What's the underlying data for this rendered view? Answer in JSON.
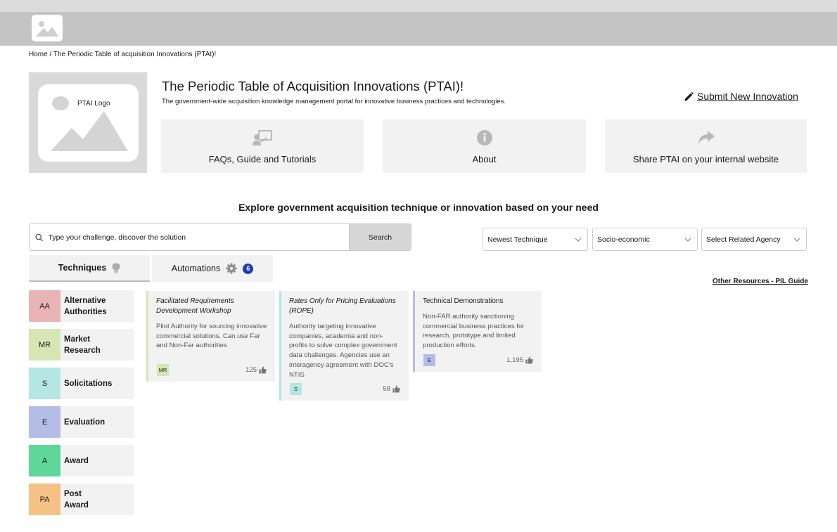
{
  "breadcrumb": {
    "home": "Home",
    "separator": " / ",
    "current": "The Periodic Table of acquisition Innovations (PTAI)!"
  },
  "hero": {
    "logo_label": "PTAI Logo",
    "title": "The Periodic Table of Acquisition Innovations (PTAI)!",
    "subtitle": "The government-wide acquisition knowledge management portal for innovative business practices and technologies.",
    "submit_label": "Submit New Innovation"
  },
  "actions": [
    {
      "label": "FAQs, Guide and Tutorials",
      "icon": "presentation-icon"
    },
    {
      "label": "About",
      "icon": "info-icon"
    },
    {
      "label": "Share PTAI on your internal website",
      "icon": "share-icon"
    }
  ],
  "explore_heading": "Explore government acquisition technique or innovation based on your need",
  "search": {
    "placeholder": "Type your challenge, discover the solution",
    "button": "Search"
  },
  "filters": [
    {
      "value": "Newest Technique"
    },
    {
      "value": "Socio-economic"
    },
    {
      "value": "Select Related Agency"
    }
  ],
  "tabs": [
    {
      "label": "Techniques",
      "icon": "lightbulb-icon",
      "active": true
    },
    {
      "label": "Automations",
      "icon": "gear-icon",
      "badge": "6"
    }
  ],
  "other_resources": "Other Resources - PIL Guide",
  "categories": [
    {
      "code": "AA",
      "name": "Alternative Authorities",
      "color": "#e8b4b4"
    },
    {
      "code": "MR",
      "name": "Market Research",
      "color": "#d6e6b4"
    },
    {
      "code": "S",
      "name": "Solicitations",
      "color": "#b4e6e4"
    },
    {
      "code": "E",
      "name": "Evaluation",
      "color": "#b4bce8"
    },
    {
      "code": "A",
      "name": "Award",
      "color": "#5fd69a"
    },
    {
      "code": "PA",
      "name": "Post Award",
      "color": "#f5c184"
    }
  ],
  "techniques": [
    {
      "title": "Facilitated Requirements Development Workshop",
      "italic": true,
      "description": "Pilot Authority for sourcing innovative commercial solutions. Can use Far and Non-Far authorities",
      "tag": "MR",
      "tag_color": "#d6e6b4",
      "border_color": "#d6e6b4",
      "likes": "125"
    },
    {
      "title": "Rates Only for Pricing Evaluations (ROPE)",
      "italic": true,
      "description": "Authority targeting innovative companies, academia and non-profits to solve complex government data challenges. Agencies use an interagency agreement with DOC's NTIS",
      "tag": "S",
      "tag_color": "#b4e6e4",
      "border_color": "#b4e6e4",
      "likes": "58"
    },
    {
      "title": "Technical Demonstrations",
      "italic": false,
      "description": "Non-FAR authority sanctioning commercial business practices for research, prototype and limited production efforts.",
      "tag": "E",
      "tag_color": "#b4bce8",
      "border_color": "#b4bce8",
      "likes": "1,195"
    }
  ]
}
